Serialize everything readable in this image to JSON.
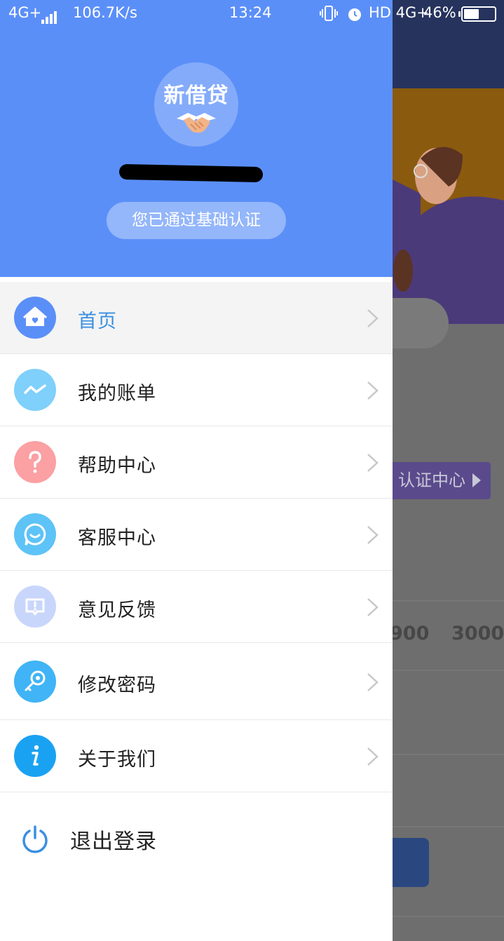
{
  "status_bar": {
    "network": "4G+",
    "speed": "106.7K/s",
    "time": "13:24",
    "hd_net": "HD 4G+",
    "battery": "46%",
    "battery_level": 0.46
  },
  "drawer": {
    "logo_text": "新借贷",
    "auth_status": "您已通过基础认证",
    "menu": [
      {
        "label": "首页",
        "icon": "home-icon",
        "color": "#5b8ff8",
        "active": true
      },
      {
        "label": "我的账单",
        "icon": "trend-icon",
        "color": "#7fd0fb"
      },
      {
        "label": "帮助中心",
        "icon": "question-icon",
        "color": "#fba0a3"
      },
      {
        "label": "客服中心",
        "icon": "chat-icon",
        "color": "#5ec3f6"
      },
      {
        "label": "意见反馈",
        "icon": "feedback-icon",
        "color": "#c9d6fb"
      },
      {
        "label": "修改密码",
        "icon": "key-icon",
        "color": "#40b4f6"
      },
      {
        "label": "关于我们",
        "icon": "info-icon",
        "color": "#1aa2f2"
      }
    ],
    "logout_label": "退出登录"
  },
  "background": {
    "verify_label": "认证中心",
    "amounts": [
      "900",
      "3000"
    ]
  },
  "colors": {
    "brand_blue": "#5b8ff8",
    "active_text": "#3a8fe2"
  }
}
